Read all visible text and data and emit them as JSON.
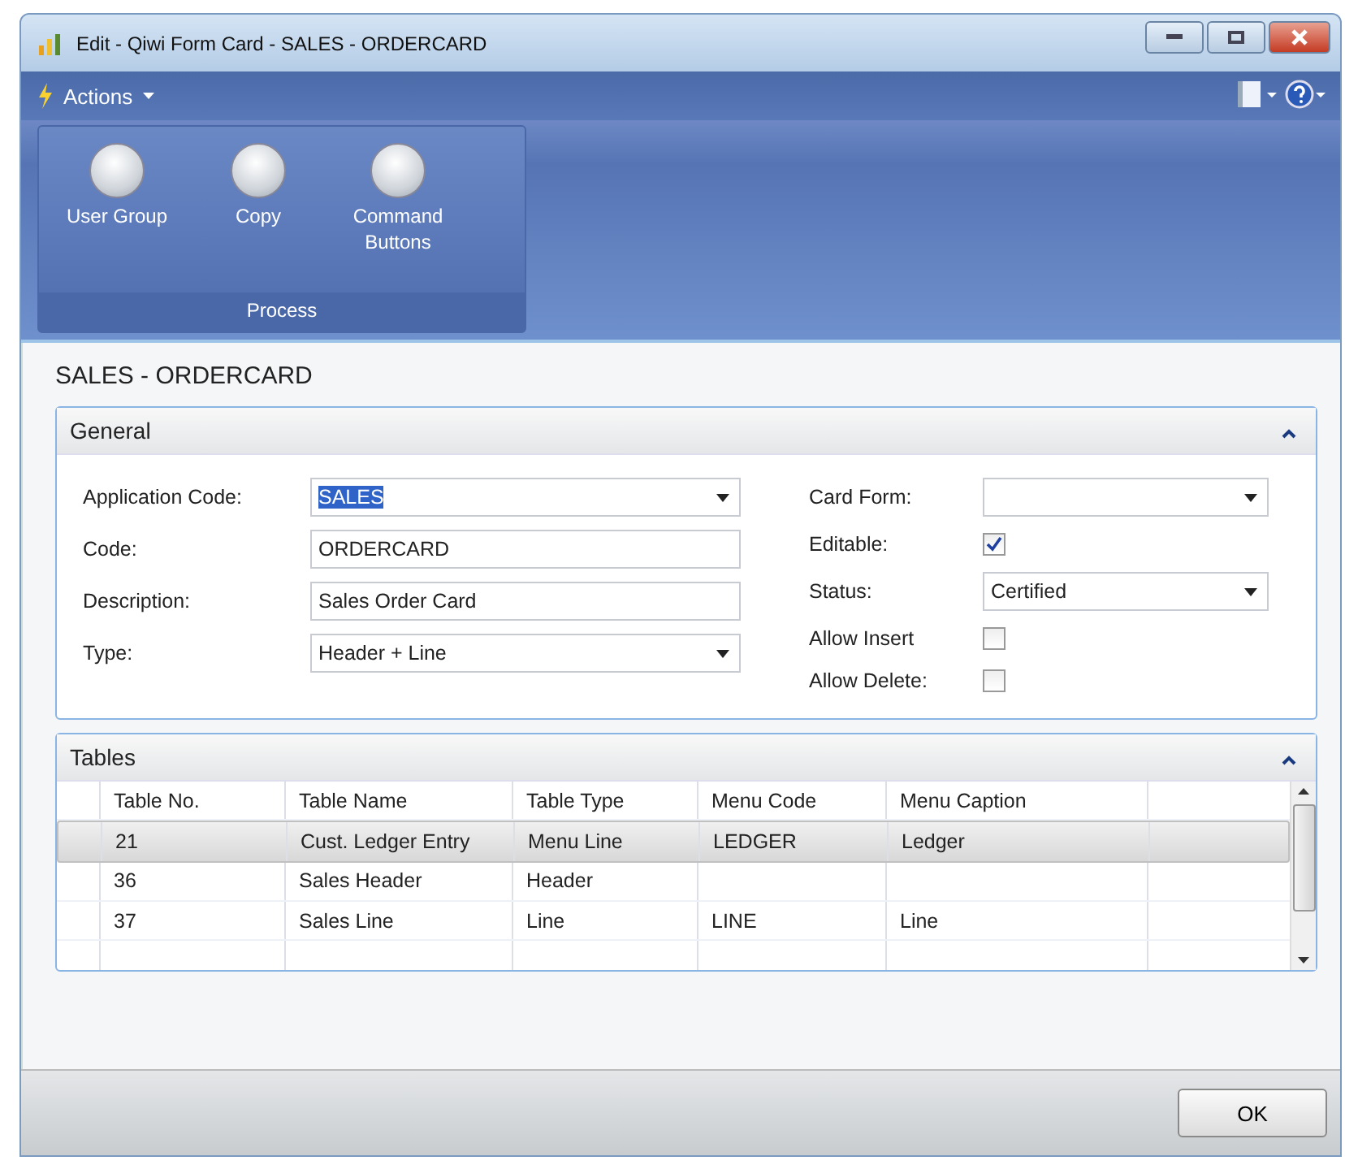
{
  "window": {
    "title": "Edit - Qiwi Form Card - SALES - ORDERCARD"
  },
  "actions_menu": {
    "label": "Actions"
  },
  "ribbon": {
    "buttons": [
      {
        "label": "User Group"
      },
      {
        "label": "Copy"
      },
      {
        "label": "Command Buttons"
      }
    ],
    "group_label": "Process"
  },
  "page_title": "SALES - ORDERCARD",
  "general": {
    "title": "General",
    "expanded": true,
    "left_fields": [
      {
        "label": "Application Code:",
        "kind": "dropdown",
        "value": "SALES",
        "text_selected": true
      },
      {
        "label": "Code:",
        "kind": "text",
        "value": "ORDERCARD",
        "text_selected": false
      },
      {
        "label": "Description:",
        "kind": "text",
        "value": "Sales Order Card",
        "text_selected": false
      },
      {
        "label": "Type:",
        "kind": "dropdown",
        "value": "Header + Line",
        "text_selected": false
      }
    ],
    "right_fields": [
      {
        "label": "Card Form:",
        "kind": "dropdown"
      },
      {
        "label": "Editable:",
        "kind": "checkbox",
        "checked": true
      },
      {
        "label": "Status:",
        "kind": "dropdown",
        "value": "Certified"
      },
      {
        "label": "Allow Insert",
        "kind": "checkbox",
        "checked": false
      },
      {
        "label": "Allow Delete:",
        "kind": "checkbox",
        "checked": false
      }
    ]
  },
  "tables": {
    "title": "Tables",
    "expanded": true,
    "columns": [
      "Table No.",
      "Table Name",
      "Table Type",
      "Menu Code",
      "Menu Caption"
    ],
    "rows": [
      {
        "cells": [
          "21",
          "Cust. Ledger Entry",
          "Menu Line",
          "LEDGER",
          "Ledger"
        ],
        "selected": true
      },
      {
        "cells": [
          "36",
          "Sales Header",
          "Header",
          "",
          ""
        ],
        "selected": false
      },
      {
        "cells": [
          "37",
          "Sales Line",
          "Line",
          "LINE",
          "Line"
        ],
        "selected": false
      }
    ]
  },
  "buttons": [
    "OK"
  ]
}
